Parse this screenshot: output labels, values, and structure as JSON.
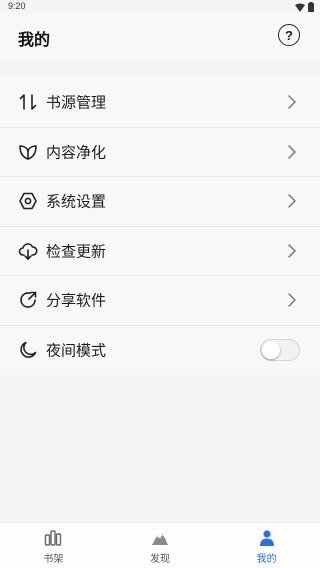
{
  "status_bar": {
    "time": "9:20"
  },
  "header": {
    "title": "我的",
    "help_icon_label": "?"
  },
  "menu": {
    "items": [
      {
        "label": "书源管理",
        "icon": "swap-vertical-icon",
        "control": "chevron"
      },
      {
        "label": "内容净化",
        "icon": "leaf-icon",
        "control": "chevron"
      },
      {
        "label": "系统设置",
        "icon": "gear-hexagon-icon",
        "control": "chevron"
      },
      {
        "label": "检查更新",
        "icon": "cloud-download-icon",
        "control": "chevron"
      },
      {
        "label": "分享软件",
        "icon": "share-arrow-icon",
        "control": "chevron"
      },
      {
        "label": "夜间模式",
        "icon": "moon-icon",
        "control": "toggle",
        "toggle_on": false
      }
    ]
  },
  "bottom_nav": {
    "tabs": [
      {
        "label": "书架",
        "icon": "bookshelf-icon",
        "active": false
      },
      {
        "label": "发现",
        "icon": "mountain-icon",
        "active": false
      },
      {
        "label": "我的",
        "icon": "person-icon",
        "active": true
      }
    ]
  },
  "colors": {
    "accent": "#2b6ee8",
    "background": "#f5f5f7"
  }
}
